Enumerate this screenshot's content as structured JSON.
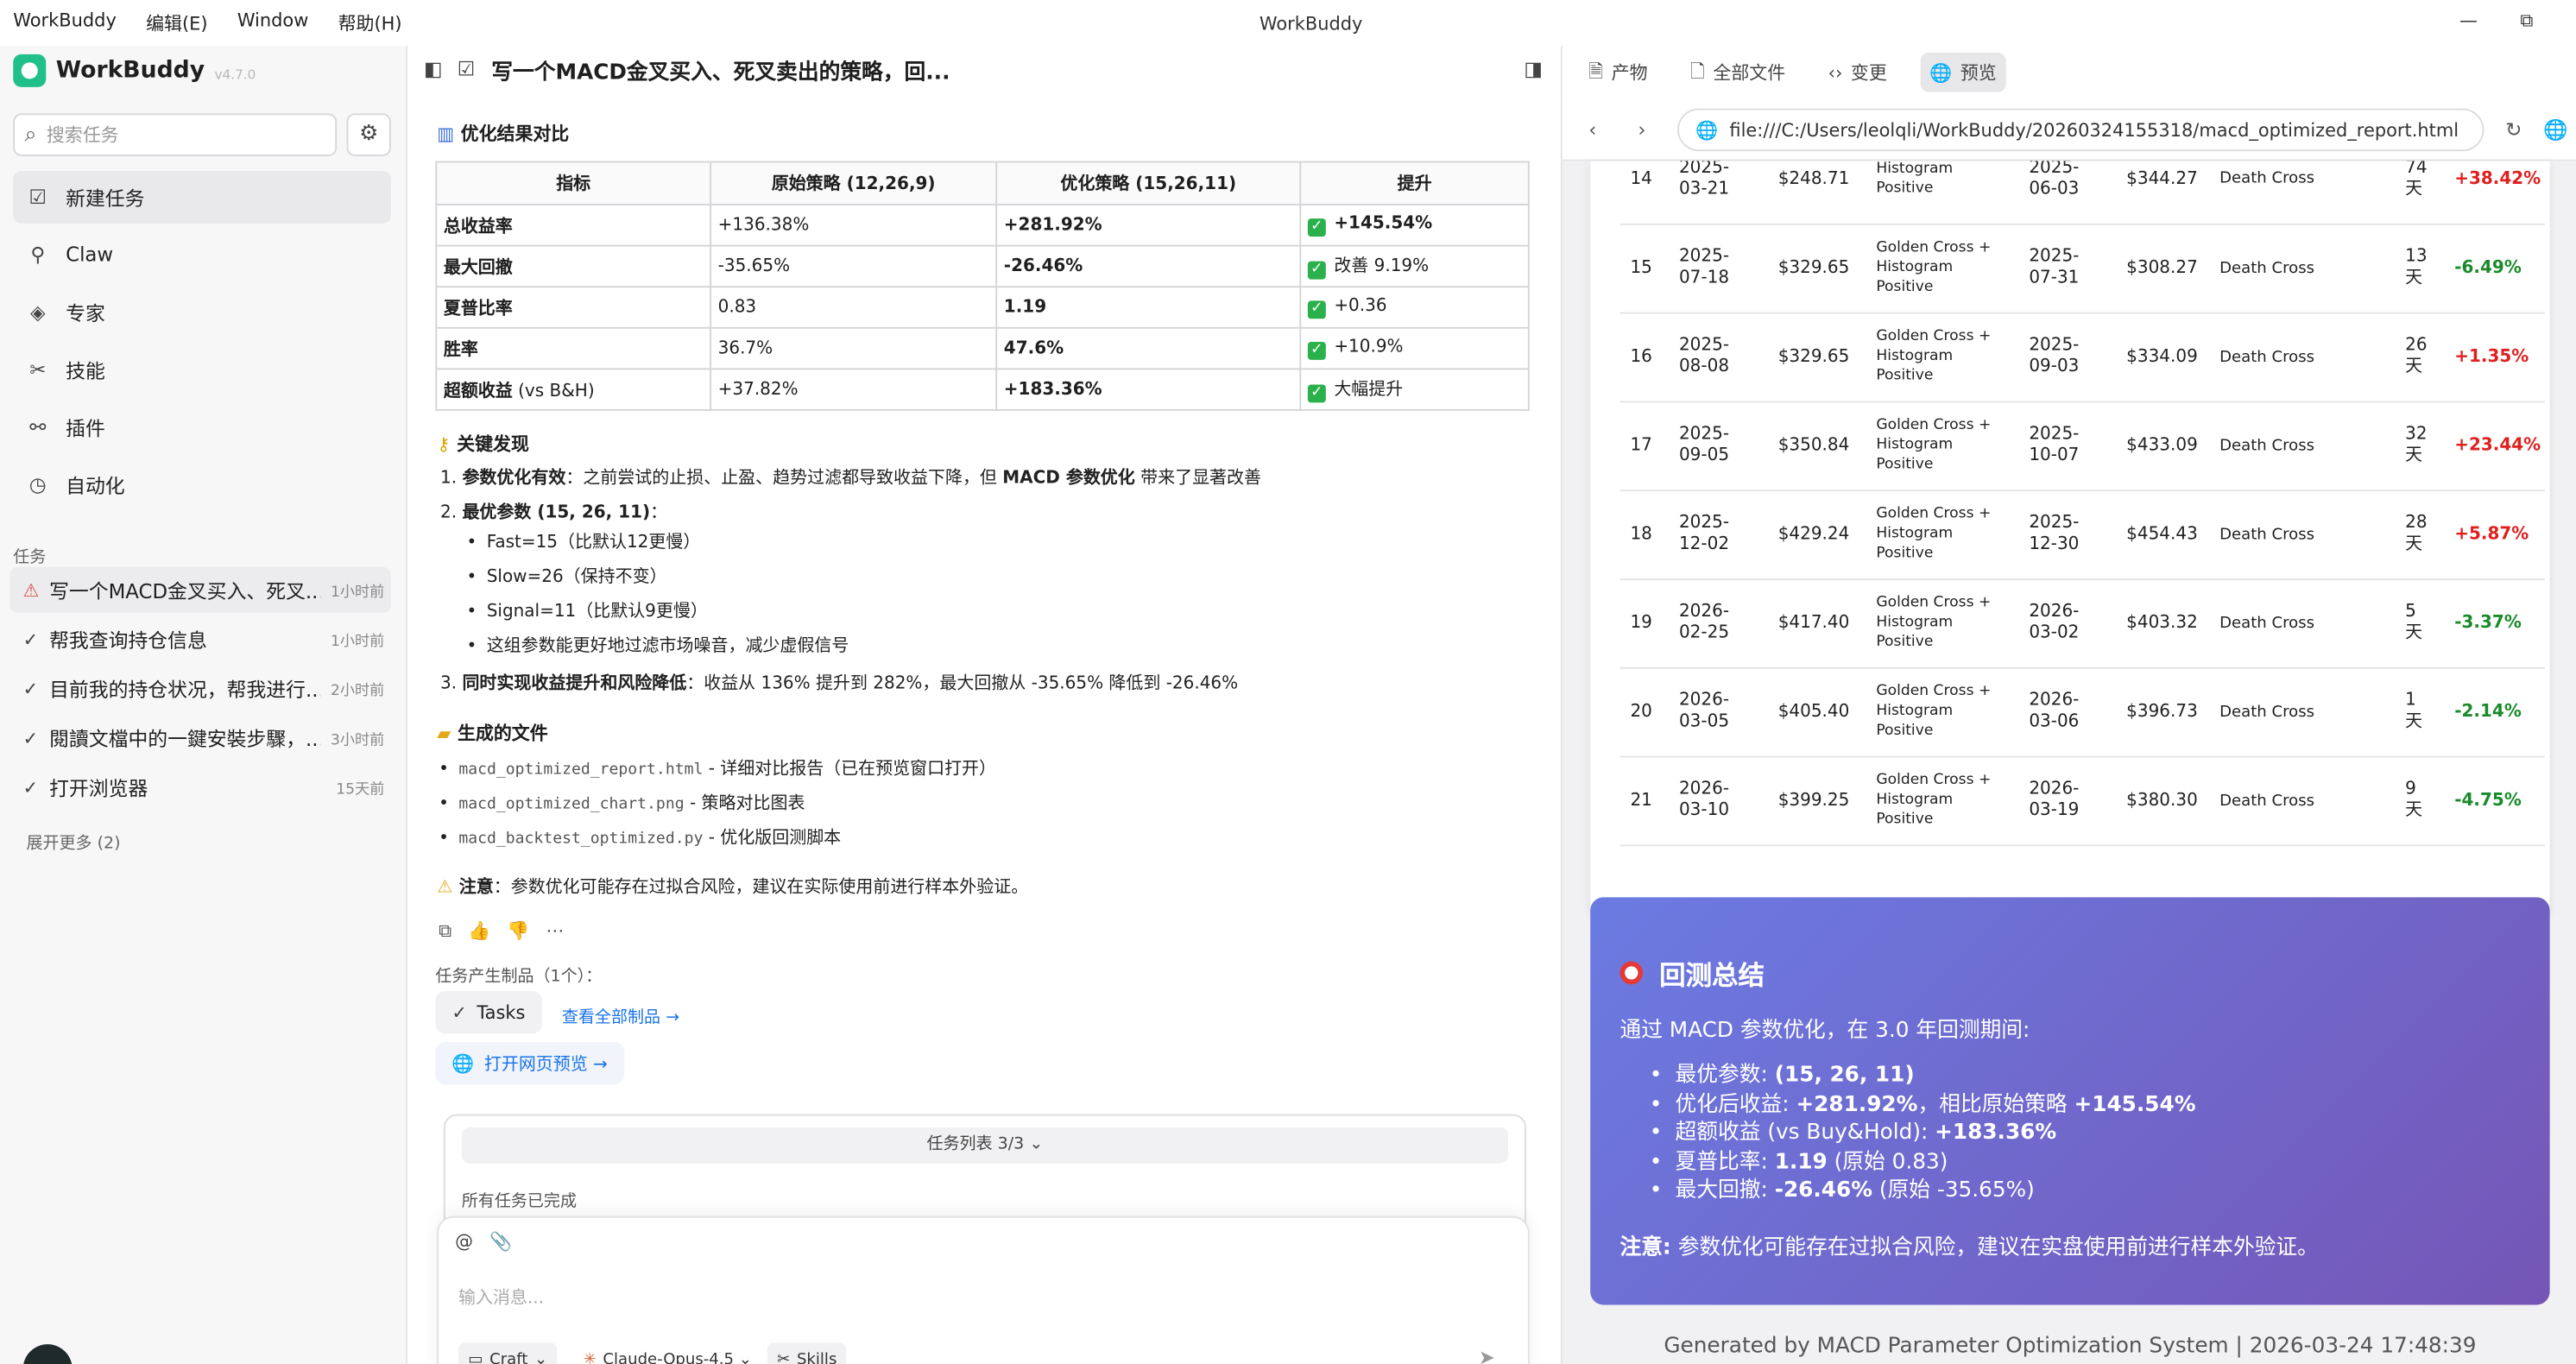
{
  "titlebar": {
    "app_menu": "WorkBuddy",
    "menu_edit": "编辑(E)",
    "menu_window": "Window",
    "menu_help": "帮助(H)",
    "title": "WorkBuddy",
    "min": "—",
    "max": "⧉"
  },
  "sidebar": {
    "brand": "WorkBuddy",
    "version": "v4.7.0",
    "search_placeholder": "搜索任务",
    "nav": [
      {
        "label": "新建任务",
        "icon": "☑"
      },
      {
        "label": "Claw",
        "icon": "⚲"
      },
      {
        "label": "专家",
        "icon": "◈"
      },
      {
        "label": "技能",
        "icon": "✂"
      },
      {
        "label": "插件",
        "icon": "⚯"
      },
      {
        "label": "自动化",
        "icon": "◷"
      }
    ],
    "tasks_header": "任务",
    "tasks": [
      {
        "title": "写一个MACD金叉买入、死叉...",
        "time": "1小时前",
        "icon": "⚠"
      },
      {
        "title": "帮我查询持仓信息",
        "time": "1小时前",
        "icon": "✓"
      },
      {
        "title": "目前我的持仓状况，帮我进行...",
        "time": "2小时前",
        "icon": "✓"
      },
      {
        "title": "閱讀文檔中的一鍵安裝步驟，...",
        "time": "3小时前",
        "icon": "✓"
      },
      {
        "title": "打开浏览器",
        "time": "15天前",
        "icon": "✓"
      }
    ],
    "more": "展开更多 (2)"
  },
  "chat": {
    "title": "写一个MACD金叉买入、死叉卖出的策略，回...",
    "compare_title": "优化结果对比",
    "table_headers": [
      "指标",
      "原始策略 (12,26,9)",
      "优化策略 (15,26,11)",
      "提升"
    ],
    "table_rows": [
      {
        "k": "总收益率",
        "ks": "",
        "o": "+136.38%",
        "n": "+281.92%",
        "u": "+145.54%",
        "ub": true
      },
      {
        "k": "最大回撤",
        "ks": "",
        "o": "-35.65%",
        "n": "-26.46%",
        "u": "改善 9.19%",
        "ub": false
      },
      {
        "k": "夏普比率",
        "ks": "",
        "o": "0.83",
        "n": "1.19",
        "u": "+0.36",
        "ub": false
      },
      {
        "k": "胜率",
        "ks": "",
        "o": "36.7%",
        "n": "47.6%",
        "u": "+10.9%",
        "ub": false
      },
      {
        "k": "超额收益",
        "ks": " (vs B&H)",
        "o": "+37.82%",
        "n": "+183.36%",
        "u": "大幅提升",
        "ub": false
      }
    ],
    "findings_title": "关键发现",
    "f1_num": "1. ",
    "f1_bold": "参数优化有效",
    "f1_rest": "：之前尝试的止损、止盈、趋势过滤都导致收益下降，但 ",
    "f1_bold2": "MACD 参数优化",
    "f1_rest2": " 带来了显著改善",
    "f2_num": "2. ",
    "f2_bold": "最优参数 (15, 26, 11)",
    "f2_rest": "：",
    "bullets": [
      "Fast=15（比默认12更慢）",
      "Slow=26（保持不变）",
      "Signal=11（比默认9更慢）",
      "这组参数能更好地过滤市场噪音，减少虚假信号"
    ],
    "f3_num": "3. ",
    "f3_bold": "同时实现收益提升和风险降低",
    "f3_rest": "：收益从 136% 提升到 282%，最大回撤从 -35.65% 降低到 -26.46%",
    "files_title": "生成的文件",
    "files": [
      {
        "name": "macd_optimized_report.html",
        "desc": " - 详细对比报告（已在预览窗口打开）"
      },
      {
        "name": "macd_optimized_chart.png",
        "desc": " - 策略对比图表"
      },
      {
        "name": "macd_backtest_optimized.py",
        "desc": " - 优化版回测脚本"
      }
    ],
    "note_bold": "注意",
    "note_rest": "：参数优化可能存在过拟合风险，建议在实际使用前进行样本外验证。",
    "products_label": "任务产生制品（1个）：",
    "tasks_pill": "Tasks",
    "view_all": "查看全部制品 →",
    "open_preview": "打开网页预览 →",
    "tasklist_label": "任务列表 3/3",
    "tasklist_done": "所有任务已完成",
    "input_placeholder": "输入消息...",
    "mode": "Craft",
    "model": "Claude-Opus-4.5",
    "skills": "Skills"
  },
  "preview": {
    "tabs": [
      {
        "label": "产物",
        "icon": "🗎"
      },
      {
        "label": "全部文件",
        "icon": "🗋"
      },
      {
        "label": "变更",
        "icon": "‹›"
      },
      {
        "label": "预览",
        "icon": "🌐"
      }
    ],
    "url": "file:///C:/Users/leolqli/WorkBuddy/20260324155318/macd_optimized_report.html",
    "trades": [
      {
        "n": "14",
        "d1": "2025-",
        "d2": "03-21",
        "bp": "$248.71",
        "s1": "Histogram",
        "s2": "Positive",
        "s3": "",
        "e1": "2025-",
        "e2": "06-03",
        "sp": "$344.27",
        "r": "Death Cross",
        "y1": "74",
        "y2": "天",
        "ret": "+38.42%",
        "pos": true
      },
      {
        "n": "15",
        "d1": "2025-",
        "d2": "07-18",
        "bp": "$329.65",
        "s1": "Golden Cross +",
        "s2": "Histogram",
        "s3": "Positive",
        "e1": "2025-",
        "e2": "07-31",
        "sp": "$308.27",
        "r": "Death Cross",
        "y1": "13",
        "y2": "天",
        "ret": "-6.49%",
        "pos": false
      },
      {
        "n": "16",
        "d1": "2025-",
        "d2": "08-08",
        "bp": "$329.65",
        "s1": "Golden Cross +",
        "s2": "Histogram",
        "s3": "Positive",
        "e1": "2025-",
        "e2": "09-03",
        "sp": "$334.09",
        "r": "Death Cross",
        "y1": "26",
        "y2": "天",
        "ret": "+1.35%",
        "pos": true
      },
      {
        "n": "17",
        "d1": "2025-",
        "d2": "09-05",
        "bp": "$350.84",
        "s1": "Golden Cross +",
        "s2": "Histogram",
        "s3": "Positive",
        "e1": "2025-",
        "e2": "10-07",
        "sp": "$433.09",
        "r": "Death Cross",
        "y1": "32",
        "y2": "天",
        "ret": "+23.44%",
        "pos": true
      },
      {
        "n": "18",
        "d1": "2025-",
        "d2": "12-02",
        "bp": "$429.24",
        "s1": "Golden Cross +",
        "s2": "Histogram",
        "s3": "Positive",
        "e1": "2025-",
        "e2": "12-30",
        "sp": "$454.43",
        "r": "Death Cross",
        "y1": "28",
        "y2": "天",
        "ret": "+5.87%",
        "pos": true
      },
      {
        "n": "19",
        "d1": "2026-",
        "d2": "02-25",
        "bp": "$417.40",
        "s1": "Golden Cross +",
        "s2": "Histogram",
        "s3": "Positive",
        "e1": "2026-",
        "e2": "03-02",
        "sp": "$403.32",
        "r": "Death Cross",
        "y1": "5",
        "y2": "天",
        "ret": "-3.37%",
        "pos": false
      },
      {
        "n": "20",
        "d1": "2026-",
        "d2": "03-05",
        "bp": "$405.40",
        "s1": "Golden Cross +",
        "s2": "Histogram",
        "s3": "Positive",
        "e1": "2026-",
        "e2": "03-06",
        "sp": "$396.73",
        "r": "Death Cross",
        "y1": "1",
        "y2": "天",
        "ret": "-2.14%",
        "pos": false
      },
      {
        "n": "21",
        "d1": "2026-",
        "d2": "03-10",
        "bp": "$399.25",
        "s1": "Golden Cross +",
        "s2": "Histogram",
        "s3": "Positive",
        "e1": "2026-",
        "e2": "03-19",
        "sp": "$380.30",
        "r": "Death Cross",
        "y1": "9",
        "y2": "天",
        "ret": "-4.75%",
        "pos": false
      }
    ],
    "summary_title": "回测总结",
    "summary_intro": "通过 MACD 参数优化，在 3.0 年回测期间:",
    "summary_items": [
      {
        "a": "最优参数: ",
        "b": "(15, 26, 11)",
        "c": "",
        "d": ""
      },
      {
        "a": "优化后收益: ",
        "b": "+281.92%",
        "c": "，相比原始策略 ",
        "d": "+145.54%"
      },
      {
        "a": "超额收益 (vs Buy&Hold): ",
        "b": "+183.36%",
        "c": "",
        "d": ""
      },
      {
        "a": "夏普比率: ",
        "b": "1.19",
        "c": " (原始 0.83)",
        "d": ""
      },
      {
        "a": "最大回撤: ",
        "b": "-26.46%",
        "c": " (原始 -35.65%)",
        "d": ""
      }
    ],
    "summary_note_bold": "注意:",
    "summary_note_rest": " 参数优化可能存在过拟合风险，建议在实盘使用前进行样本外验证。",
    "footer": "Generated by MACD Parameter Optimization System | 2026-03-24 17:48:39",
    "colors": {
      "positive": "#e0201f",
      "negative": "#1a8a2a",
      "gradient_start": "#6b7be2",
      "gradient_end": "#7556b6"
    }
  }
}
